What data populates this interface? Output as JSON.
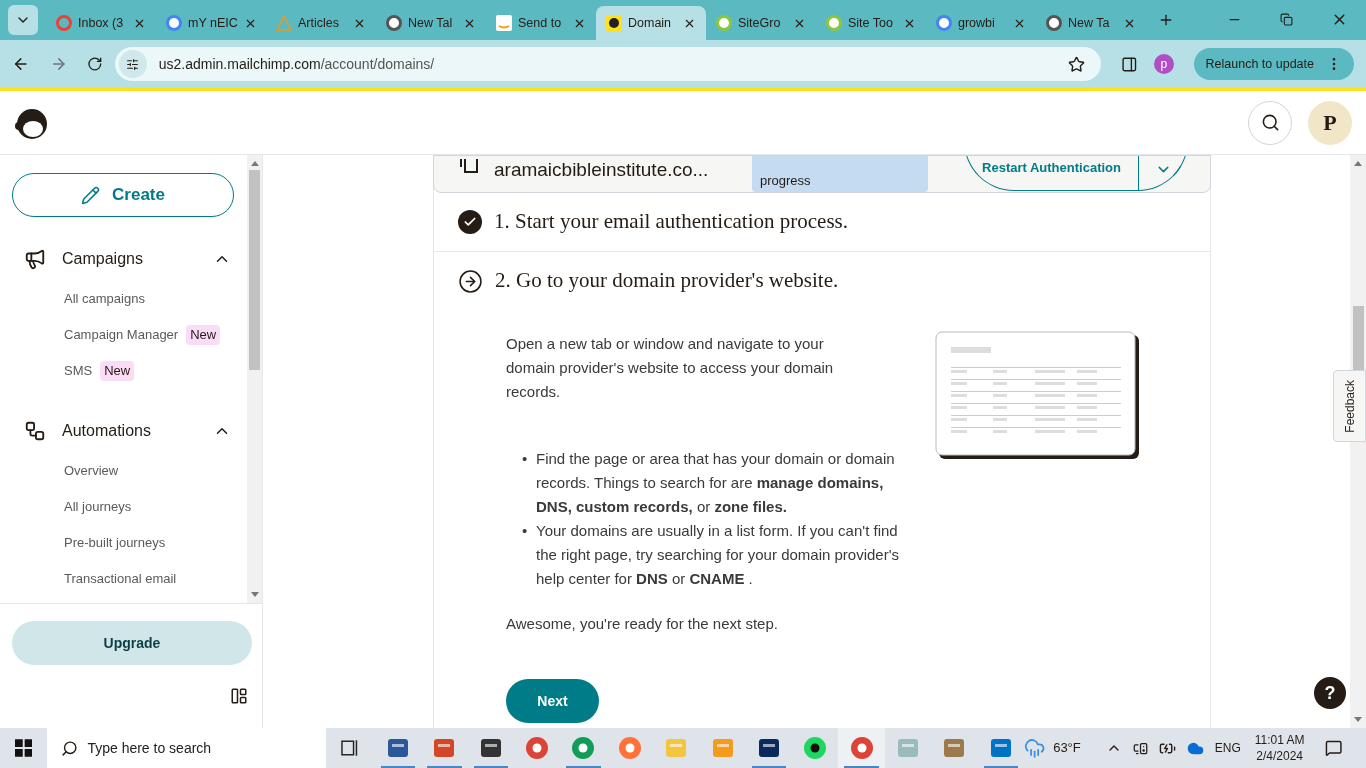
{
  "browser": {
    "tabs": [
      {
        "title": "Inbox (3",
        "kind": "mail",
        "selected": false
      },
      {
        "title": "mY nEIC",
        "kind": "google",
        "selected": false
      },
      {
        "title": "Articles",
        "kind": "triangle",
        "selected": false
      },
      {
        "title": "New Tal",
        "kind": "chrome",
        "selected": false
      },
      {
        "title": "Send to",
        "kind": "amazon",
        "selected": false
      },
      {
        "title": "Domain",
        "kind": "chimp",
        "selected": true
      },
      {
        "title": "SiteGro",
        "kind": "swirl",
        "selected": false
      },
      {
        "title": "Site Too",
        "kind": "swirl",
        "selected": false
      },
      {
        "title": "growbi",
        "kind": "google",
        "selected": false
      },
      {
        "title": "New Ta",
        "kind": "chrome",
        "selected": false
      }
    ],
    "url_host": "us2.admin.mailchimp.com",
    "url_path": "/account/domains/",
    "profile": "p",
    "relaunch": "Relaunch to update"
  },
  "header": {
    "avatar": "P"
  },
  "sidebar": {
    "create": "Create",
    "sections": [
      {
        "title": "Campaigns",
        "kind": "megaphone",
        "expanded": true,
        "items": [
          {
            "label": "All campaigns"
          },
          {
            "label": "Campaign Manager",
            "badge": "New"
          },
          {
            "label": "SMS",
            "badge": "New"
          }
        ]
      },
      {
        "title": "Automations",
        "kind": "flow",
        "expanded": true,
        "items": [
          {
            "label": "Overview"
          },
          {
            "label": "All journeys"
          },
          {
            "label": "Pre-built journeys"
          },
          {
            "label": "Transactional email"
          }
        ]
      }
    ],
    "upgrade": "Upgrade"
  },
  "domain_card": {
    "domain": "aramaicbibleinstitute.co...",
    "status": "progress",
    "action": "Restart Authentication"
  },
  "steps": [
    {
      "title": "1. Start your email authentication process.",
      "done": true
    },
    {
      "title": "2. Go to your domain provider's website.",
      "done": false,
      "intro": "Open a new tab or window and navigate to your domain provider's website to access your domain records.",
      "marker": "•",
      "bullets": [
        "Find the page or area that has your domain or domain records. Things to search for are **manage domains, DNS, custom records,** or **zone files.**",
        "Your domains are usually in a list form. If you can't find the right page, try searching for your domain provider's help center for **DNS** or **CNAME** ."
      ],
      "outro": "Awesome, you're ready for the next step.",
      "button": "Next"
    }
  ],
  "feedback": "Feedback",
  "help": "?",
  "taskbar": {
    "search_placeholder": "Type here to search",
    "apps": [
      {
        "kind": "word",
        "running": true,
        "selected": false
      },
      {
        "kind": "powerpoint",
        "running": true,
        "selected": false
      },
      {
        "kind": "notes",
        "running": true,
        "selected": false
      },
      {
        "kind": "chrome",
        "running": false,
        "selected": false
      },
      {
        "kind": "edge",
        "running": true,
        "selected": false
      },
      {
        "kind": "firefox",
        "running": false,
        "selected": false
      },
      {
        "kind": "folder",
        "running": false,
        "selected": false
      },
      {
        "kind": "media",
        "running": false,
        "selected": false
      },
      {
        "kind": "photoshop",
        "running": true,
        "selected": false
      },
      {
        "kind": "spotify",
        "running": false,
        "selected": false
      },
      {
        "kind": "chrome",
        "running": true,
        "selected": true
      },
      {
        "kind": "monitor",
        "running": false,
        "selected": false
      },
      {
        "kind": "book",
        "running": false,
        "selected": false
      },
      {
        "kind": "outlook",
        "running": true,
        "selected": false
      }
    ],
    "weather": "63°F",
    "language": "ENG",
    "time": "11:01 AM",
    "date": "2/4/2024"
  }
}
